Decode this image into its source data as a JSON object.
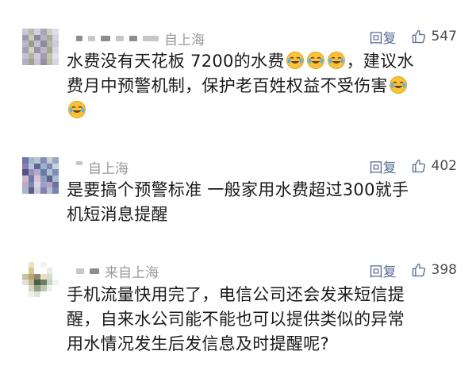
{
  "comments": [
    {
      "location": "自上海",
      "reply": "回复",
      "likes": "547",
      "line1": "水费没有天花板 7200的水费",
      "line1b": "，建议水",
      "line2": "费月中预警机制，保护老百姓权益不受伤害",
      "emoji": "crying-laughing-face-icon"
    },
    {
      "location": "自上海",
      "reply": "回复",
      "likes": "402",
      "line1": "是要搞个预警标准 一般家用水费超过300就手",
      "line2": "机短消息提醒"
    },
    {
      "location": "来自上海",
      "reply": "回复",
      "likes": "398",
      "line1": "手机流量快用完了，电信公司还会发来短信提",
      "line2": "醒，自来水公司能不能也可以提供类似的异常",
      "line3": "用水情况发生后发信息及时提醒呢?"
    }
  ],
  "colors": {
    "reply": "#576b95",
    "meta": "#9a9a9a",
    "text": "#1a1a1a"
  }
}
